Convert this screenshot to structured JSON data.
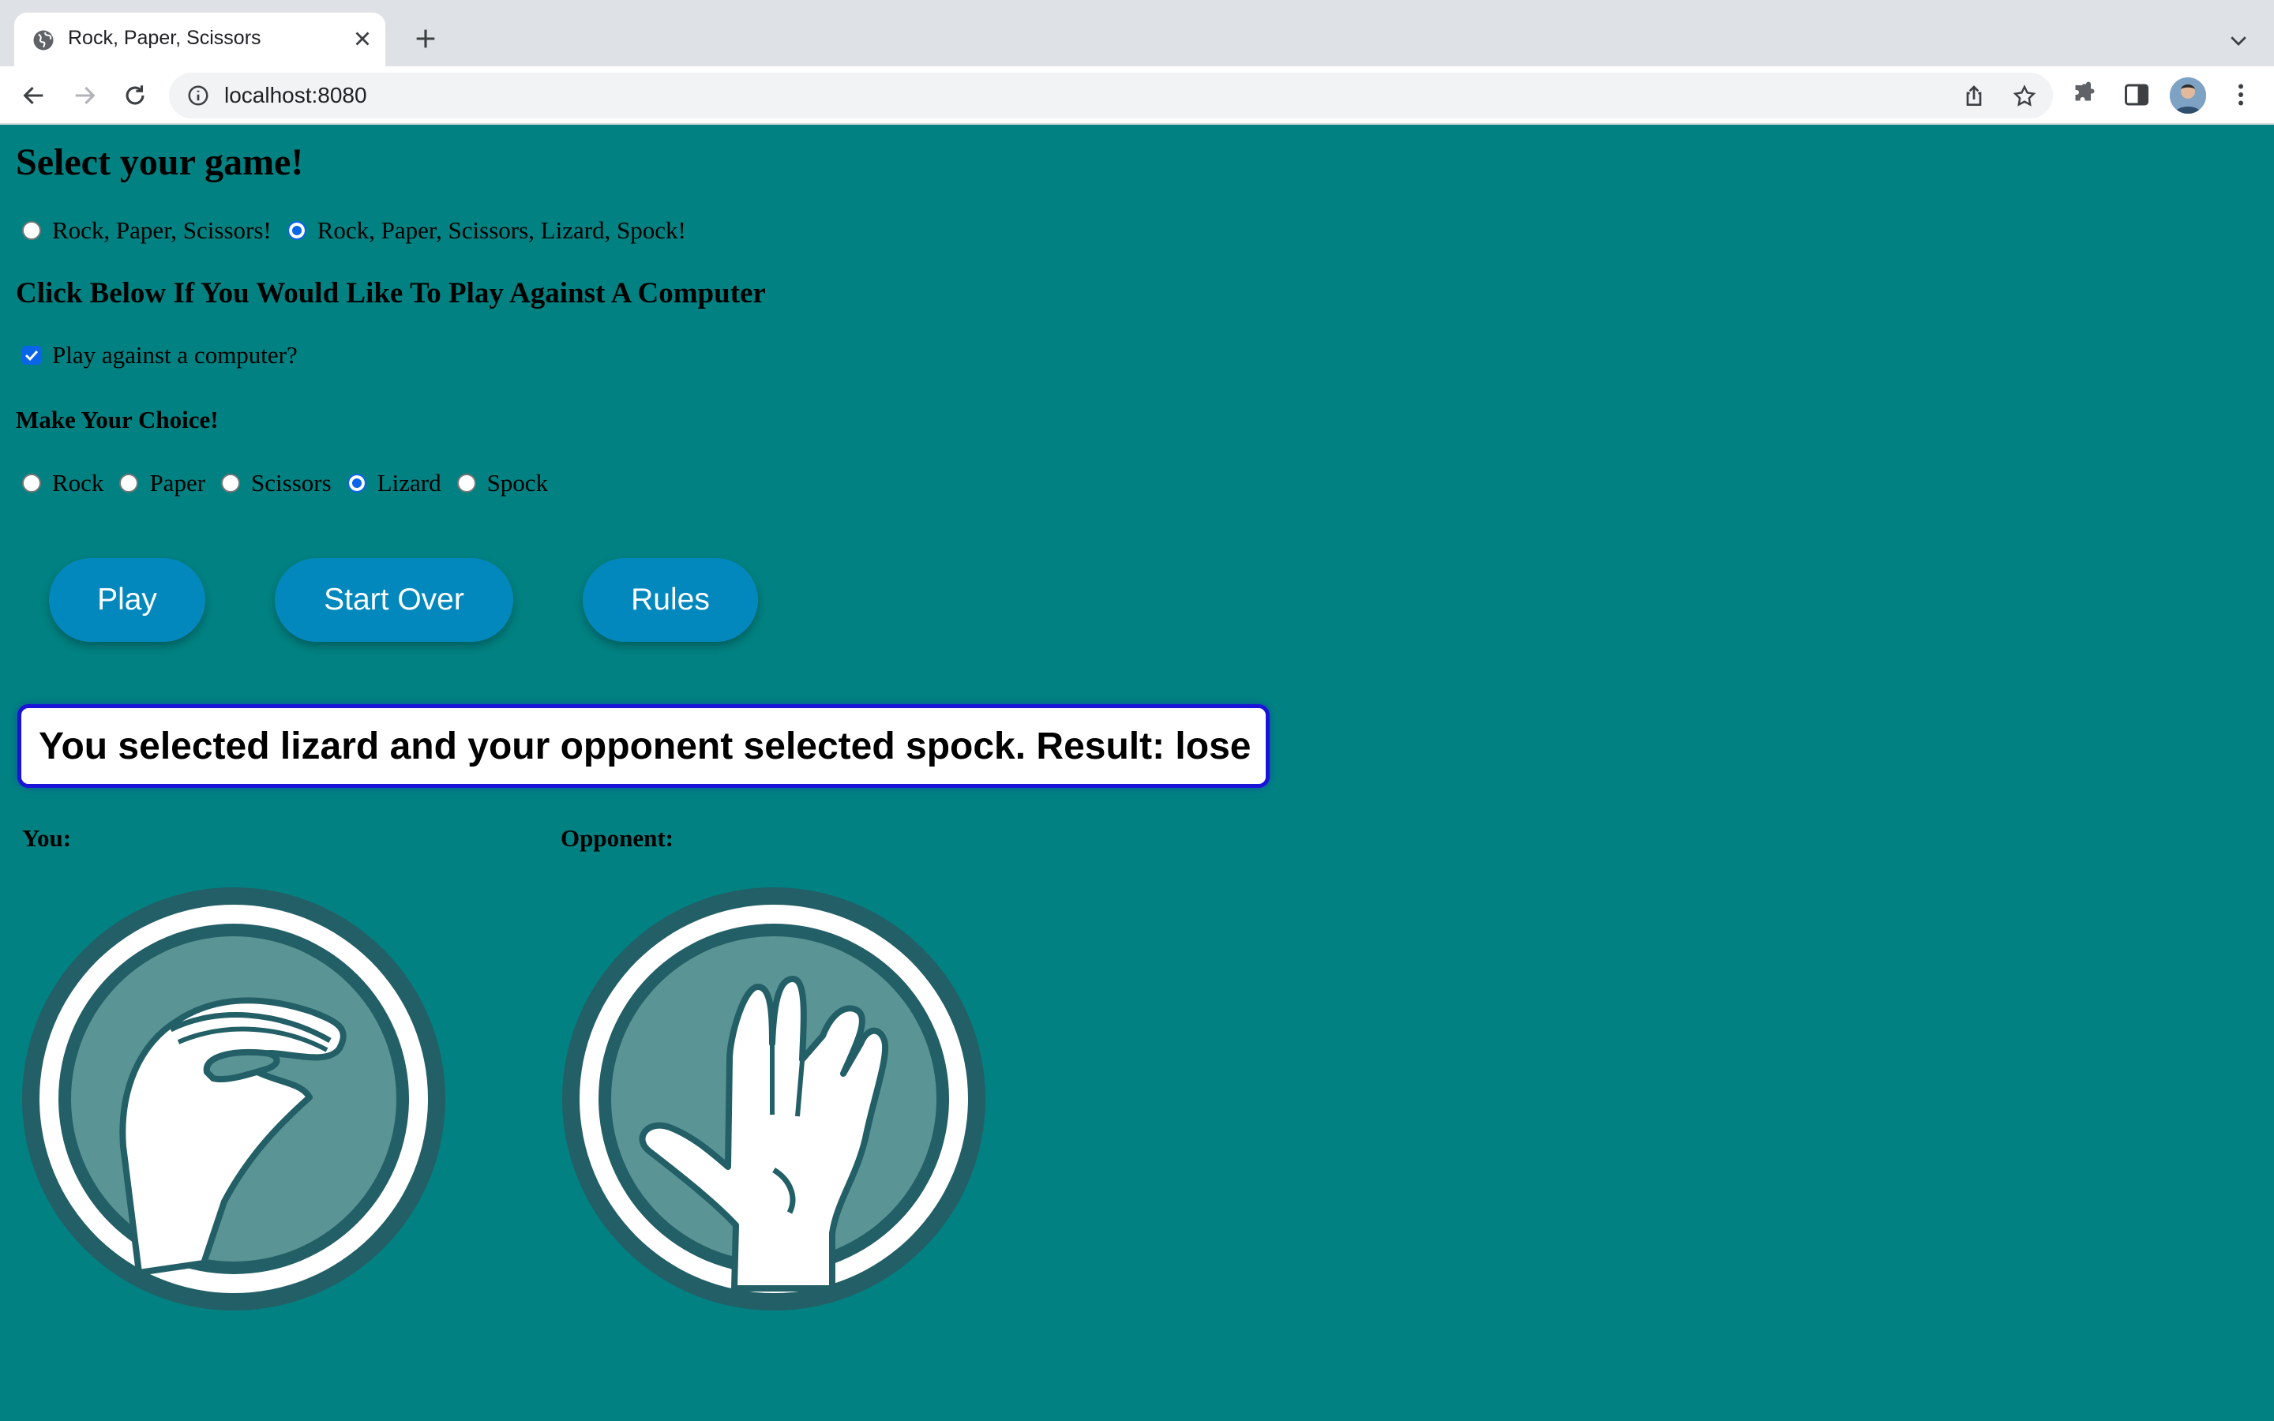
{
  "browser": {
    "tab_title": "Rock, Paper, Scissors",
    "url": "localhost:8080"
  },
  "page": {
    "game_heading": "Select your game!",
    "game_options": [
      {
        "label": "Rock, Paper, Scissors!",
        "selected": false
      },
      {
        "label": "Rock, Paper, Scissors, Lizard, Spock!",
        "selected": true
      }
    ],
    "computer_heading": "Click Below If You Would Like To Play Against A Computer",
    "computer_checkbox_label": "Play against a computer?",
    "computer_checked": true,
    "choice_heading": "Make Your Choice!",
    "choices": [
      {
        "label": "Rock",
        "selected": false
      },
      {
        "label": "Paper",
        "selected": false
      },
      {
        "label": "Scissors",
        "selected": false
      },
      {
        "label": "Lizard",
        "selected": true
      },
      {
        "label": "Spock",
        "selected": false
      }
    ],
    "buttons": {
      "play": "Play",
      "start_over": "Start Over",
      "rules": "Rules"
    },
    "result_text": "You selected lizard and your opponent selected spock. Result: lose",
    "you_label": "You:",
    "opponent_label": "Opponent:",
    "you_choice_icon": "lizard-hand-icon",
    "opponent_choice_icon": "spock-hand-icon"
  },
  "colors": {
    "page_background": "#018181",
    "button": "#0288bd",
    "result_border": "#1b14d8",
    "icon_ring": "#235f66",
    "icon_fill": "#5a9494"
  }
}
